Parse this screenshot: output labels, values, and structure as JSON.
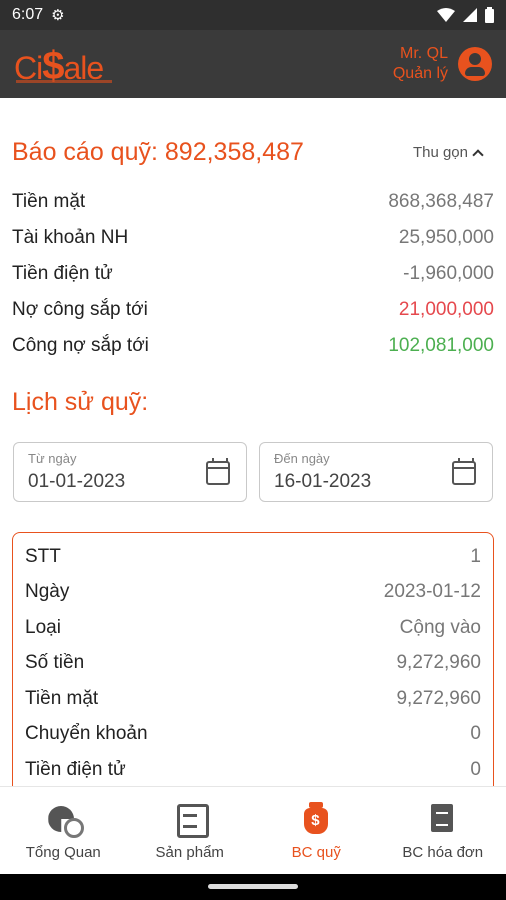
{
  "status_bar": {
    "time": "6:07",
    "gear_icon": "gear-icon",
    "wifi_icon": "wifi-icon",
    "signal_icon": "signal-icon",
    "battery_icon": "battery-icon"
  },
  "header": {
    "logo": "CiSale",
    "user_name": "Mr. QL",
    "user_role": "Quản lý",
    "avatar_icon": "account-circle-icon"
  },
  "report": {
    "title": "Báo cáo quỹ: 892,358,487",
    "collapse_label": "Thu gọn",
    "rows": [
      {
        "label": "Tiền mặt",
        "value": "868,368,487",
        "tone": ""
      },
      {
        "label": "Tài khoản NH",
        "value": "25,950,000",
        "tone": ""
      },
      {
        "label": "Tiền điện tử",
        "value": "-1,960,000",
        "tone": ""
      },
      {
        "label": "Nợ công sắp tới",
        "value": "21,000,000",
        "tone": "red"
      },
      {
        "label": "Công nợ sắp tới",
        "value": "102,081,000",
        "tone": "green"
      }
    ]
  },
  "history": {
    "title": "Lịch sử quỹ:",
    "from": {
      "label": "Từ ngày",
      "value": "01-01-2023"
    },
    "to": {
      "label": "Đến ngày",
      "value": "16-01-2023"
    },
    "card": [
      {
        "label": "STT",
        "value": "1"
      },
      {
        "label": "Ngày",
        "value": "2023-01-12"
      },
      {
        "label": "Loại",
        "value": "Cộng vào"
      },
      {
        "label": "Số tiền",
        "value": "9,272,960"
      },
      {
        "label": "Tiền mặt",
        "value": "9,272,960"
      },
      {
        "label": "Chuyển khoản",
        "value": "0"
      },
      {
        "label": "Tiền điện tử",
        "value": "0"
      }
    ]
  },
  "nav": {
    "items": [
      {
        "label": "Tổng Quan",
        "icon": "overview-icon"
      },
      {
        "label": "Sản phẩm",
        "icon": "products-icon"
      },
      {
        "label": "BC quỹ",
        "icon": "money-bag-icon"
      },
      {
        "label": "BC hóa đơn",
        "icon": "invoice-icon"
      }
    ]
  },
  "colors": {
    "accent": "#e8521e",
    "negative": "#e5484d",
    "positive": "#4caf50",
    "header_bg": "#3a3a3a"
  }
}
